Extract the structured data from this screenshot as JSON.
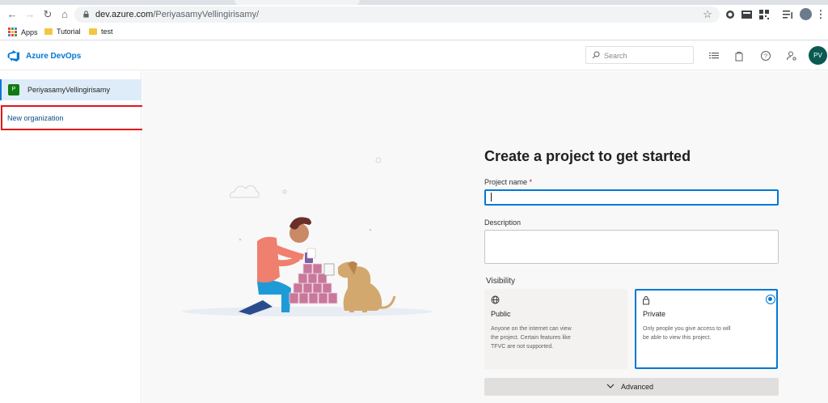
{
  "browser": {
    "url_host": "dev.azure.com",
    "url_path": "/PeriyasamyVellingirisamy/",
    "bookmarks": [
      "Apps",
      "Tutorial",
      "test"
    ]
  },
  "header": {
    "brand": "Azure DevOps",
    "search_placeholder": "Search",
    "avatar_initials": "PV"
  },
  "sidebar": {
    "org_badge": "P",
    "org_name": "PeriyasamyVellingirisamy",
    "new_org_label": "New organization"
  },
  "form": {
    "title": "Create a project to get started",
    "project_name_label": "Project name",
    "required_mark": "*",
    "project_name_value": "",
    "description_label": "Description",
    "description_value": "",
    "visibility_label": "Visibility",
    "public_title": "Public",
    "public_desc": "Anyone on the internet can view the project. Certain features like TFVC are not supported.",
    "private_title": "Private",
    "private_desc": "Only people you give access to will be able to view this project.",
    "selected_visibility": "Private",
    "advanced_label": "Advanced"
  },
  "colors": {
    "brand_blue": "#0078d4",
    "highlight_red": "#e3161b",
    "avatar_bg": "#0b5a52",
    "org_badge_bg": "#107c10"
  }
}
